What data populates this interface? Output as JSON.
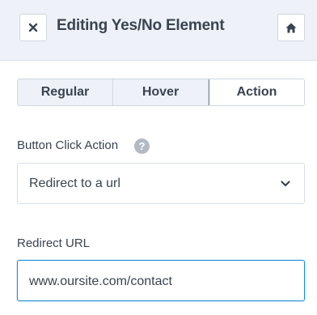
{
  "header": {
    "title": "Editing Yes/No Element",
    "close_icon": "close-icon",
    "home_icon": "home-icon"
  },
  "tabs": [
    {
      "label": "Regular",
      "active": false
    },
    {
      "label": "Hover",
      "active": false
    },
    {
      "label": "Action",
      "active": true
    }
  ],
  "button_click_action": {
    "label": "Button Click Action",
    "help_glyph": "?",
    "selected": "Redirect to a url"
  },
  "redirect_url": {
    "label": "Redirect URL",
    "value": "www.oursite.com/contact"
  },
  "colors": {
    "header_bg": "#eef2f8",
    "text": "#3a4350",
    "focus_border": "#1a8fd6",
    "help_icon_bg": "#b4bac3"
  }
}
